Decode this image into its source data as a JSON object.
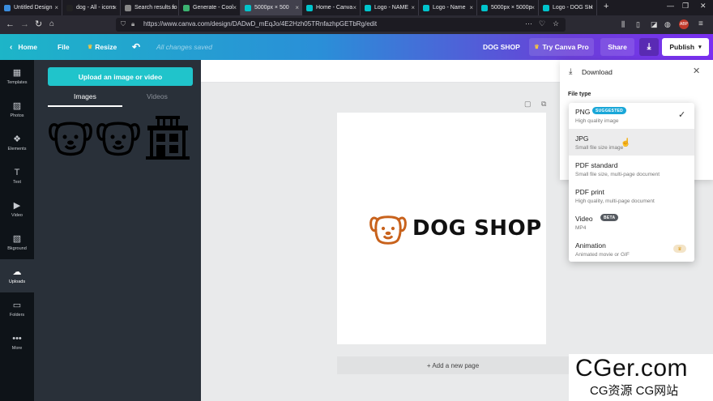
{
  "browser": {
    "tabs": [
      {
        "label": "Untitled Design",
        "active": false,
        "favicon_color": "#3a8dde"
      },
      {
        "label": "dog - All - icons",
        "active": false,
        "favicon_color": "#222222"
      },
      {
        "label": "Search results fo",
        "active": false,
        "favicon_color": "#888888"
      },
      {
        "label": "Generate - Cool",
        "active": false,
        "favicon_color": "#3cb371"
      },
      {
        "label": "5000px × 500",
        "active": true,
        "favicon_color": "#00c4cc"
      },
      {
        "label": "Home - Canva",
        "active": false,
        "favicon_color": "#00c4cc"
      },
      {
        "label": "Logo - NAME",
        "active": false,
        "favicon_color": "#00c4cc"
      },
      {
        "label": "Logo - Name",
        "active": false,
        "favicon_color": "#00c4cc"
      },
      {
        "label": "5000px × 5000p",
        "active": false,
        "favicon_color": "#00c4cc"
      },
      {
        "label": "Logo - DOG SH",
        "active": false,
        "favicon_color": "#00c4cc"
      }
    ],
    "new_tab": "+",
    "url": "https://www.canva.com/design/DADwD_mEqJo/4E2Hzh05TRnfazhpGETbRg/edit",
    "url_more": "···"
  },
  "header": {
    "home": "Home",
    "file": "File",
    "resize": "Resize",
    "saved_status": "All changes saved",
    "design_title": "DOG SHOP",
    "try_pro": "Try Canva Pro",
    "share": "Share",
    "publish": "Publish"
  },
  "rail": [
    {
      "label": "Templates",
      "icon": "templates-icon",
      "glyph": "▦"
    },
    {
      "label": "Photos",
      "icon": "photos-icon",
      "glyph": "▨"
    },
    {
      "label": "Elements",
      "icon": "elements-icon",
      "glyph": "❖"
    },
    {
      "label": "Text",
      "icon": "text-icon",
      "glyph": "T"
    },
    {
      "label": "Video",
      "icon": "video-icon",
      "glyph": "▶"
    },
    {
      "label": "Bkground",
      "icon": "background-icon",
      "glyph": "▧"
    },
    {
      "label": "Uploads",
      "icon": "uploads-icon",
      "glyph": "☁",
      "active": true
    },
    {
      "label": "Folders",
      "icon": "folders-icon",
      "glyph": "▭"
    },
    {
      "label": "More",
      "icon": "more-icon",
      "glyph": "•••"
    }
  ],
  "panel": {
    "upload_button": "Upload an image or video",
    "tabs": [
      "Images",
      "Videos"
    ],
    "active_tab": "Images"
  },
  "canvas": {
    "logo_text": "DOG SHOP",
    "logo_color": "#c8621c",
    "add_page": "+ Add a new page"
  },
  "download": {
    "title": "Download",
    "file_type_label": "File type",
    "options": [
      {
        "title": "PNG",
        "subtitle": "High quality image",
        "badge": "SUGGESTED",
        "selected": true
      },
      {
        "title": "JPG",
        "subtitle": "Small file size image",
        "hovered": true
      },
      {
        "title": "PDF standard",
        "subtitle": "Small file size, multi-page document"
      },
      {
        "title": "PDF print",
        "subtitle": "High quality, multi-page document"
      },
      {
        "title": "Video",
        "subtitle": "MP4",
        "badge": "BETA"
      },
      {
        "title": "Animation",
        "subtitle": "Animated movie or GIF",
        "crown": true
      }
    ]
  },
  "watermark": {
    "main": "CGer.com",
    "sub": "CG资源  CG网站"
  }
}
